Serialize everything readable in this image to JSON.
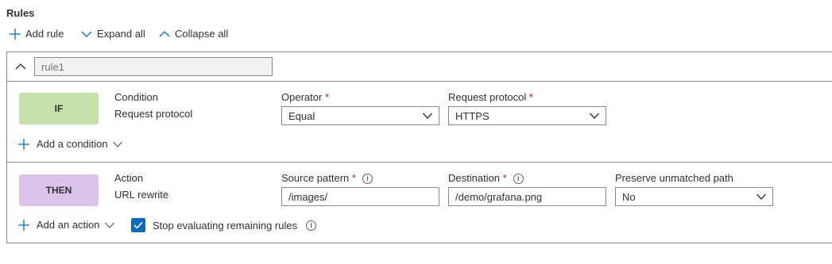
{
  "header": {
    "title": "Rules"
  },
  "toolbar": {
    "add_rule": "Add rule",
    "expand_all": "Expand all",
    "collapse_all": "Collapse all"
  },
  "rule": {
    "name_placeholder": "rule1",
    "condition": {
      "badge": "IF",
      "type_label": "Condition",
      "type_value": "Request protocol",
      "operator_label": "Operator",
      "operator_value": "Equal",
      "protocol_label": "Request protocol",
      "protocol_value": "HTTPS",
      "add_condition": "Add a condition"
    },
    "action": {
      "badge": "THEN",
      "type_label": "Action",
      "type_value": "URL rewrite",
      "source_label": "Source pattern",
      "source_value": "/images/",
      "destination_label": "Destination",
      "destination_value": "/demo/grafana.png",
      "preserve_label": "Preserve unmatched path",
      "preserve_value": "No",
      "add_action": "Add an action",
      "stop_label": "Stop evaluating remaining rules",
      "stop_checked": true
    },
    "required_mark": "*",
    "info_glyph": "i"
  },
  "colors": {
    "if_badge": "#c5e0a8",
    "then_badge": "#dcc3ea",
    "accent": "#0f6cbd"
  }
}
